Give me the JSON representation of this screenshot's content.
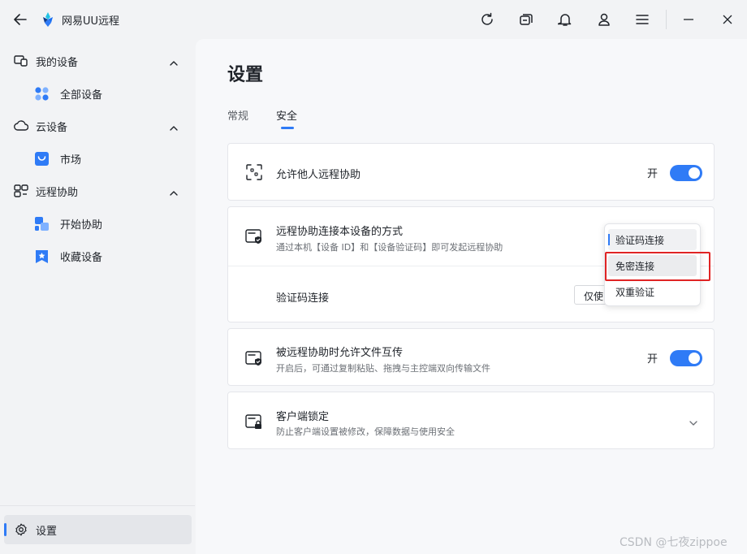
{
  "app": {
    "title": "网易UU远程"
  },
  "sidebar": {
    "groups": [
      {
        "label": "我的设备",
        "icon": "devices-icon",
        "items": [
          {
            "label": "全部设备",
            "icon": "grid-icon"
          }
        ]
      },
      {
        "label": "云设备",
        "icon": "cloud-icon",
        "items": [
          {
            "label": "市场",
            "icon": "shopping-bag-icon"
          }
        ]
      },
      {
        "label": "远程协助",
        "icon": "remote-assist-icon",
        "items": [
          {
            "label": "开始协助",
            "icon": "start-assist-icon"
          },
          {
            "label": "收藏设备",
            "icon": "star-bookmark-icon"
          }
        ]
      }
    ],
    "settings": {
      "label": "设置",
      "icon": "gear-icon"
    }
  },
  "main": {
    "title": "设置",
    "tabs": [
      {
        "label": "常规",
        "active": false
      },
      {
        "label": "安全",
        "active": true
      }
    ]
  },
  "cards": {
    "allow_remote": {
      "title": "允许他人远程协助",
      "toggle_label": "开",
      "enabled": true
    },
    "connection": {
      "title": "远程协助连接本设备的方式",
      "subtitle": "通过本机【设备 ID】和【设备验证码】即可发起远程协助",
      "sub_row_label": "验证码连接",
      "select_value": "仅使",
      "dropdown_options": [
        "验证码连接",
        "免密连接",
        "双重验证"
      ],
      "selected_option": "验证码连接",
      "highlighted_option": "免密连接"
    },
    "file_transfer": {
      "title": "被远程协助时允许文件互传",
      "subtitle": "开启后，可通过复制粘贴、拖拽与主控端双向传输文件",
      "toggle_label": "开",
      "enabled": true
    },
    "client_lock": {
      "title": "客户端锁定",
      "subtitle": "防止客户端设置被修改，保障数据与使用安全"
    }
  },
  "watermark": "CSDN @七夜zippoe",
  "colors": {
    "accent": "#2f7bf6",
    "highlight_box": "#e02424"
  }
}
